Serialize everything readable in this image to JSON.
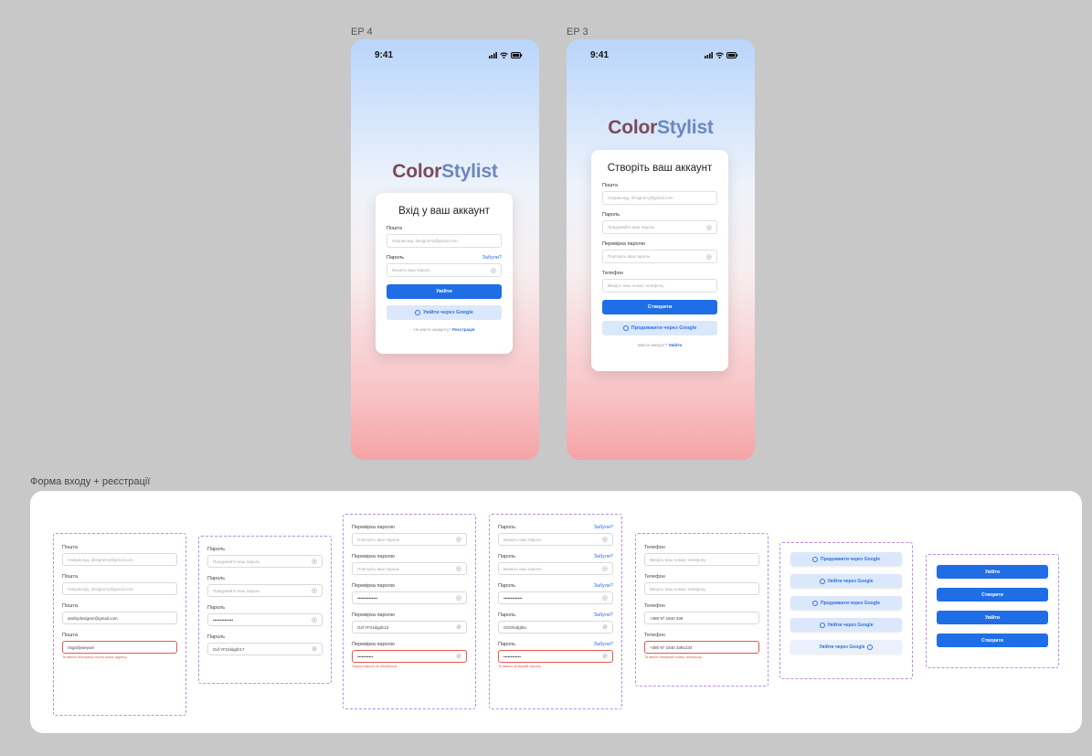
{
  "frames": {
    "login_label": "EP 4",
    "register_label": "EP 3"
  },
  "status": {
    "time": "9:41",
    "signal": "…•",
    "battery": "▬"
  },
  "logo": {
    "part1": "Color",
    "part2": "Stylist"
  },
  "login": {
    "title": "Вхід у ваш аккаунт",
    "email_label": "Пошта",
    "email_placeholder": "Наприклад, designerry@gmail.com",
    "password_label": "Пароль",
    "forgot": "Забули?",
    "password_placeholder": "Вкажіть ваш пароль",
    "submit": "Увійти",
    "google": "Увійти через Google",
    "no_account": "Не маєте аккаунту?",
    "register_link": "Реєстрація"
  },
  "register": {
    "title": "Створіть ваш аккаунт",
    "email_label": "Пошта",
    "email_placeholder": "Наприклад, designerry@gmail.com",
    "password_label": "Пароль",
    "password_placeholder": "Придумайте ваш пароль",
    "confirm_label": "Перевірка паролю",
    "confirm_placeholder": "Повторіть ваш пароль",
    "phone_label": "Телефон",
    "phone_placeholder": "Введіть ваш номер телефону",
    "submit": "Створити",
    "google": "Продовжити через Google",
    "have_account": "Маєте аккаунт?",
    "login_link": "Увійти"
  },
  "section_title": "Форма входу + реєстрації",
  "col1": [
    {
      "label": "Пошта",
      "value": "Наприклад, designerry@gmail.com",
      "state": "placeholder"
    },
    {
      "label": "Пошта",
      "value": "Наприклад, designerry@gmail.com",
      "state": "placeholder"
    },
    {
      "label": "Пошта",
      "value": "andriydesigner@gmail.com",
      "state": "filled"
    },
    {
      "label": "Пошта",
      "value": "rtsgrafyweyuei",
      "state": "error",
      "error": "Ти ввела неіснуючу пошту якась адресу"
    }
  ],
  "col2": [
    {
      "label": "Пароль",
      "value": "Придумайте ваш пароль",
      "state": "placeholder"
    },
    {
      "label": "Пароль",
      "value": "Придумайте ваш пароль",
      "state": "placeholder"
    },
    {
      "label": "Пароль",
      "value": "••••••••••••••",
      "state": "filled"
    },
    {
      "label": "Пароль",
      "value": "Gxf YF21klgdz17",
      "state": "filled"
    }
  ],
  "col3": [
    {
      "label": "Перевірка паролю",
      "value": "Повторіть ваш пароль",
      "state": "placeholder"
    },
    {
      "label": "Перевірка паролю",
      "value": "Повторіть ваш пароль",
      "state": "placeholder"
    },
    {
      "label": "Перевірка паролю",
      "value": "••••••••••••••",
      "state": "filled"
    },
    {
      "label": "Перевірка паролю",
      "value": "Gxf YF21klgdz12",
      "state": "filled"
    },
    {
      "label": "Перевірка паролю",
      "value": "•••••••••••",
      "state": "error",
      "error": "Паролі паролі не збігаються"
    }
  ],
  "col4": [
    {
      "label": "Пароль",
      "forgot": "Забули?",
      "value": "Вкажіть ваш пароль",
      "state": "placeholder"
    },
    {
      "label": "Пароль",
      "forgot": "Забули?",
      "value": "Вкажіть ваш пароль",
      "state": "placeholder"
    },
    {
      "label": "Пароль",
      "forgot": "Забули?",
      "value": "•••••••••••••",
      "state": "filled"
    },
    {
      "label": "Пароль",
      "forgot": "Забули?",
      "value": "OOOlvdghtu",
      "state": "filled"
    },
    {
      "label": "Пароль",
      "forgot": "Забули?",
      "value": "••••••••••••",
      "state": "error",
      "error": "Ти ввели не вірний пароль"
    }
  ],
  "col5": [
    {
      "label": "Телефон",
      "value": "Введіть ваш номер телефону",
      "state": "placeholder"
    },
    {
      "label": "Телефон",
      "value": "Введіть ваш номер телефону",
      "state": "placeholder"
    },
    {
      "label": "Телефон",
      "value": "+380 97 1840 339",
      "state": "filled"
    },
    {
      "label": "Телефон",
      "value": "+380 97 1840 3391234",
      "state": "error",
      "error": "Ти ввели невірний номер телефону"
    }
  ],
  "col6": [
    "Продовжити через Google",
    "Увійти через Google",
    "Продовжити через Google",
    "Увійти через Google",
    "Увійти через Google"
  ],
  "col7": [
    "Увійти",
    "Створити",
    "Увійти",
    "Створити"
  ]
}
